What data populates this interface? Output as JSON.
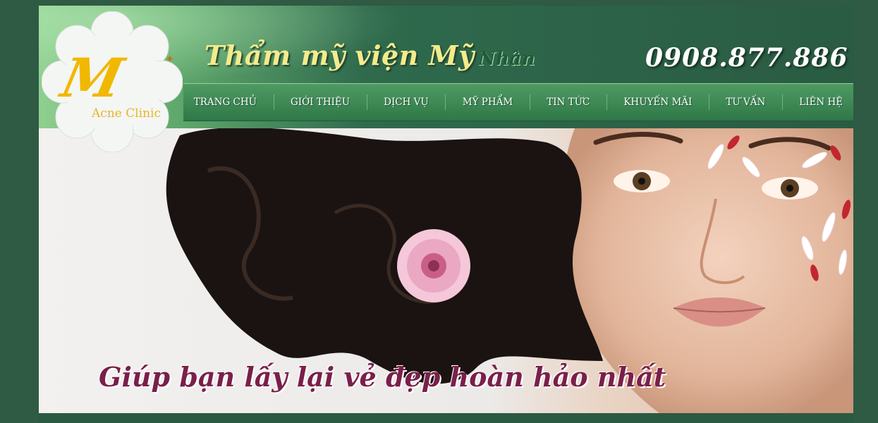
{
  "header": {
    "title_main": "Thẩm mỹ viện Mỹ",
    "title_accent": "Nhân",
    "phone": "0908.877.886"
  },
  "logo": {
    "letter": "M",
    "text": "Acne Clinic"
  },
  "nav": {
    "items": [
      {
        "label": "TRANG CHỦ"
      },
      {
        "label": "GIỚI THIỆU"
      },
      {
        "label": "DỊCH VỤ"
      },
      {
        "label": "MỸ PHẨM"
      },
      {
        "label": "TIN TỨC"
      },
      {
        "label": "KHUYẾN MÃI"
      },
      {
        "label": "TƯ VẤN"
      },
      {
        "label": "LIÊN HỆ"
      }
    ]
  },
  "banner": {
    "slogan": "Giúp bạn lấy lại vẻ đẹp hoàn hảo nhất"
  },
  "colors": {
    "page_bg": "#2f5a43",
    "header_green": "#2a5b43",
    "nav_green": "#3f8a55",
    "title_gold": "#f3eb8c",
    "slogan_maroon": "#7a1f4a",
    "logo_gold": "#f1b800"
  }
}
